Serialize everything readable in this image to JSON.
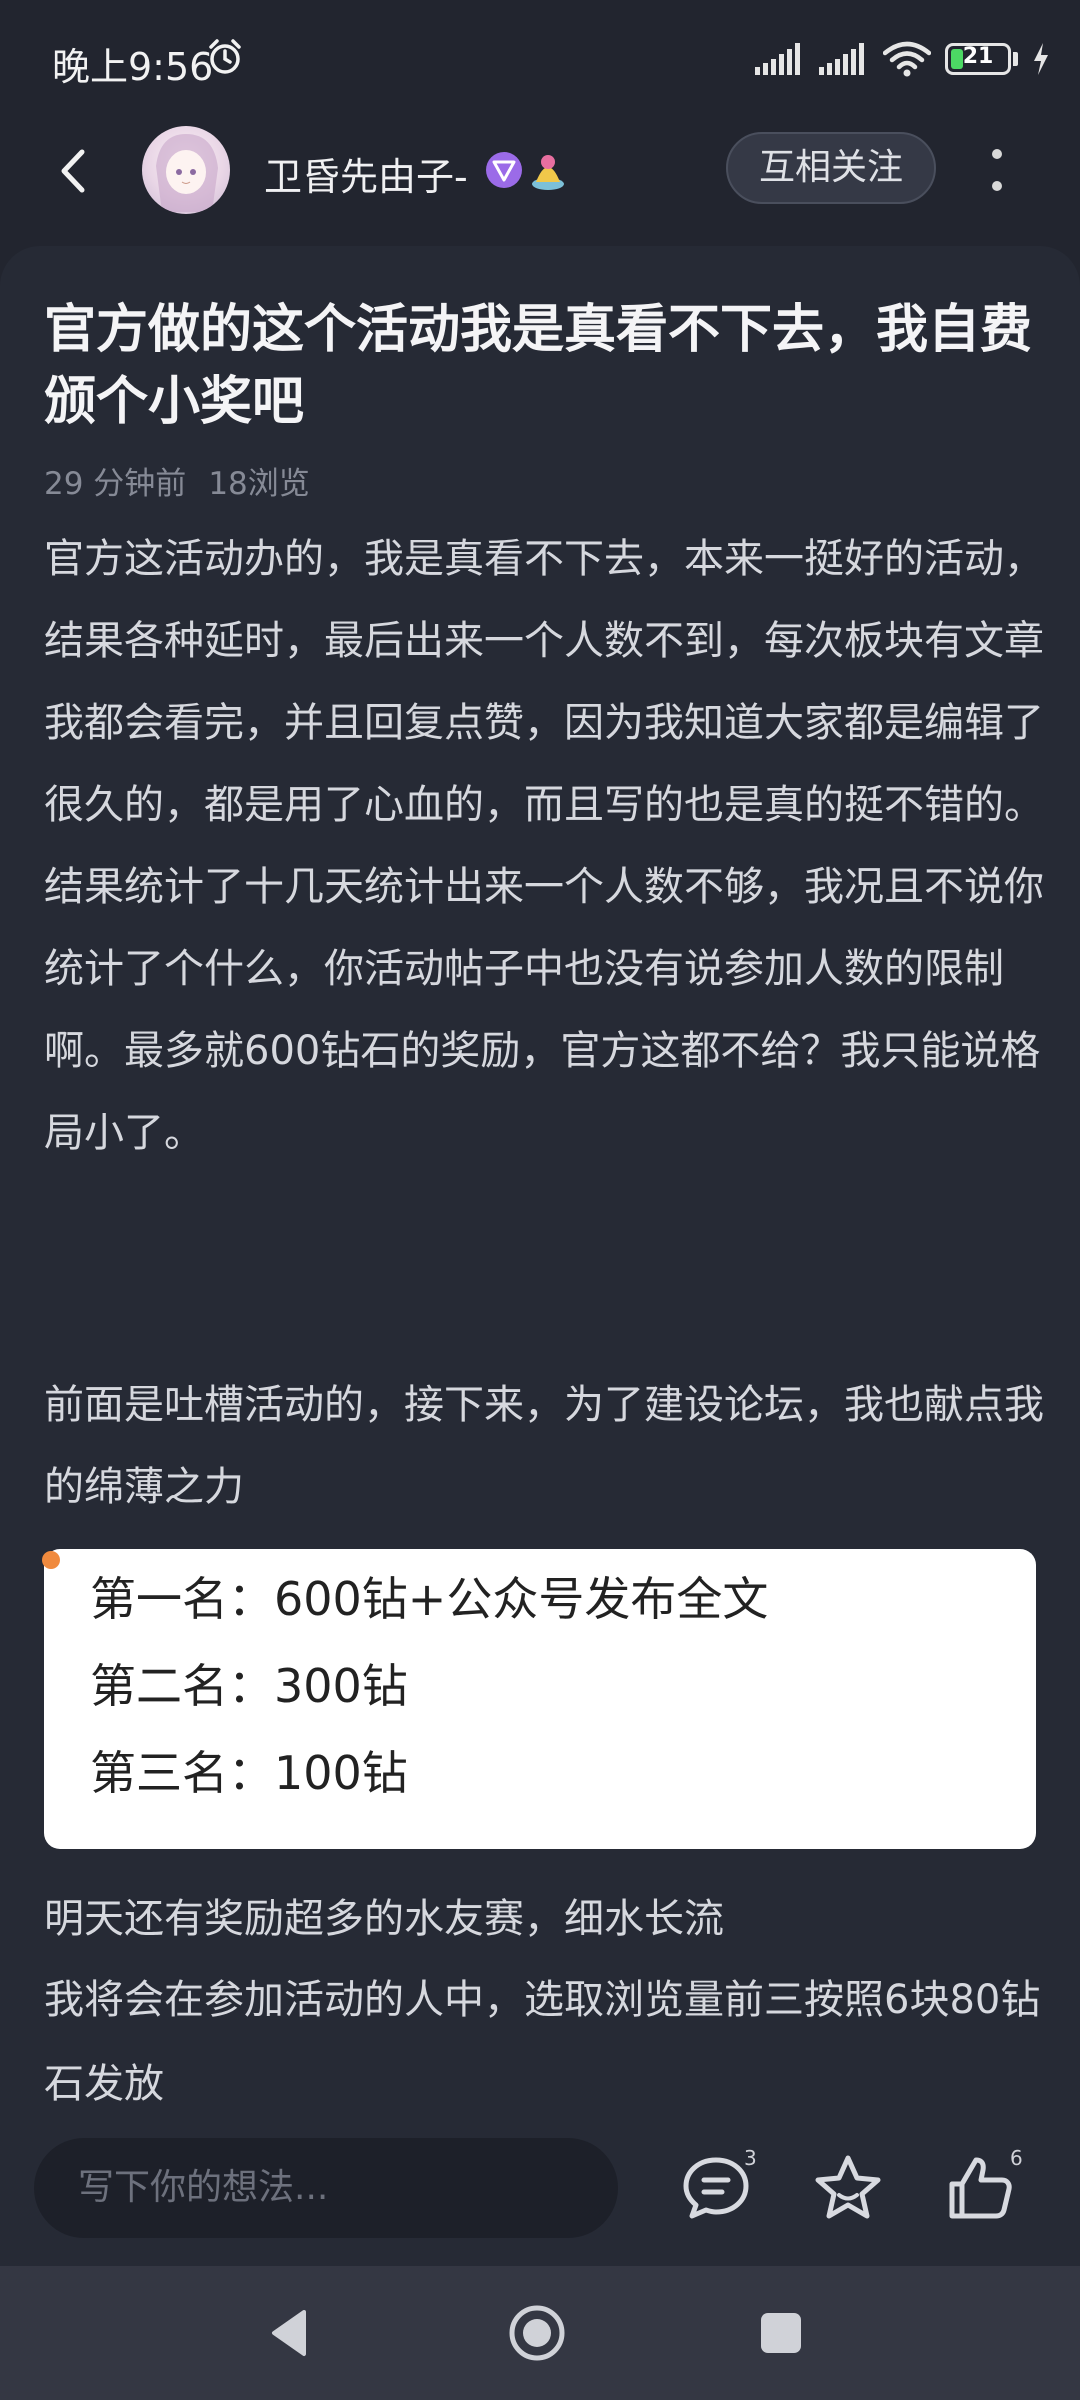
{
  "status_bar": {
    "time": "晚上9:56",
    "battery_level": "21",
    "icons": [
      "alarm-icon",
      "signal-icon",
      "signal-icon",
      "wifi-icon",
      "battery-icon",
      "charging-icon"
    ]
  },
  "header": {
    "username": "卫昏先由子-",
    "follow_label": "互相关注",
    "icons": [
      "back-arrow-icon",
      "avatar",
      "level-badge-icon",
      "medal-badge-icon",
      "more-vertical-icon"
    ]
  },
  "post": {
    "title": "官方做的这个活动我是真看不下去，我自费颁个小奖吧",
    "time_ago": "29 分钟前",
    "views": "18浏览",
    "paragraph1": "官方这活动办的，我是真看不下去，本来一挺好的活动，结果各种延时，最后出来一个人数不到，每次板块有文章我都会看完，并且回复点赞，因为我知道大家都是编辑了很久的，都是用了心血的，而且写的也是真的挺不错的。结果统计了十几天统计出来一个人数不够，我况且不说你统计了个什么，你活动帖子中也没有说参加人数的限制啊。最多就600钻石的奖励，官方这都不给？我只能说格局小了。",
    "paragraph2": "前面是吐槽活动的，接下来，为了建设论坛，我也献点我的绵薄之力",
    "prizes": [
      "第一名：600钻+公众号发布全文",
      "第二名：300钻",
      "第三名：100钻"
    ],
    "paragraph3": "明天还有奖励超多的水友赛，细水长流",
    "paragraph4": "我将会在参加活动的人中，选取浏览量前三按照6块80钻石发放"
  },
  "comment_bar": {
    "placeholder": "写下你的想法...",
    "comment_count": "3",
    "like_count": "6",
    "icons": [
      "comment-icon",
      "favorite-star-icon",
      "like-thumb-icon"
    ]
  },
  "nav_bar": {
    "icons": [
      "nav-back-icon",
      "nav-home-icon",
      "nav-recents-icon"
    ]
  },
  "colors": {
    "background": "#22252f",
    "card": "#262a35",
    "accent_orange": "#f08a3e",
    "battery_green": "#4cd964"
  }
}
